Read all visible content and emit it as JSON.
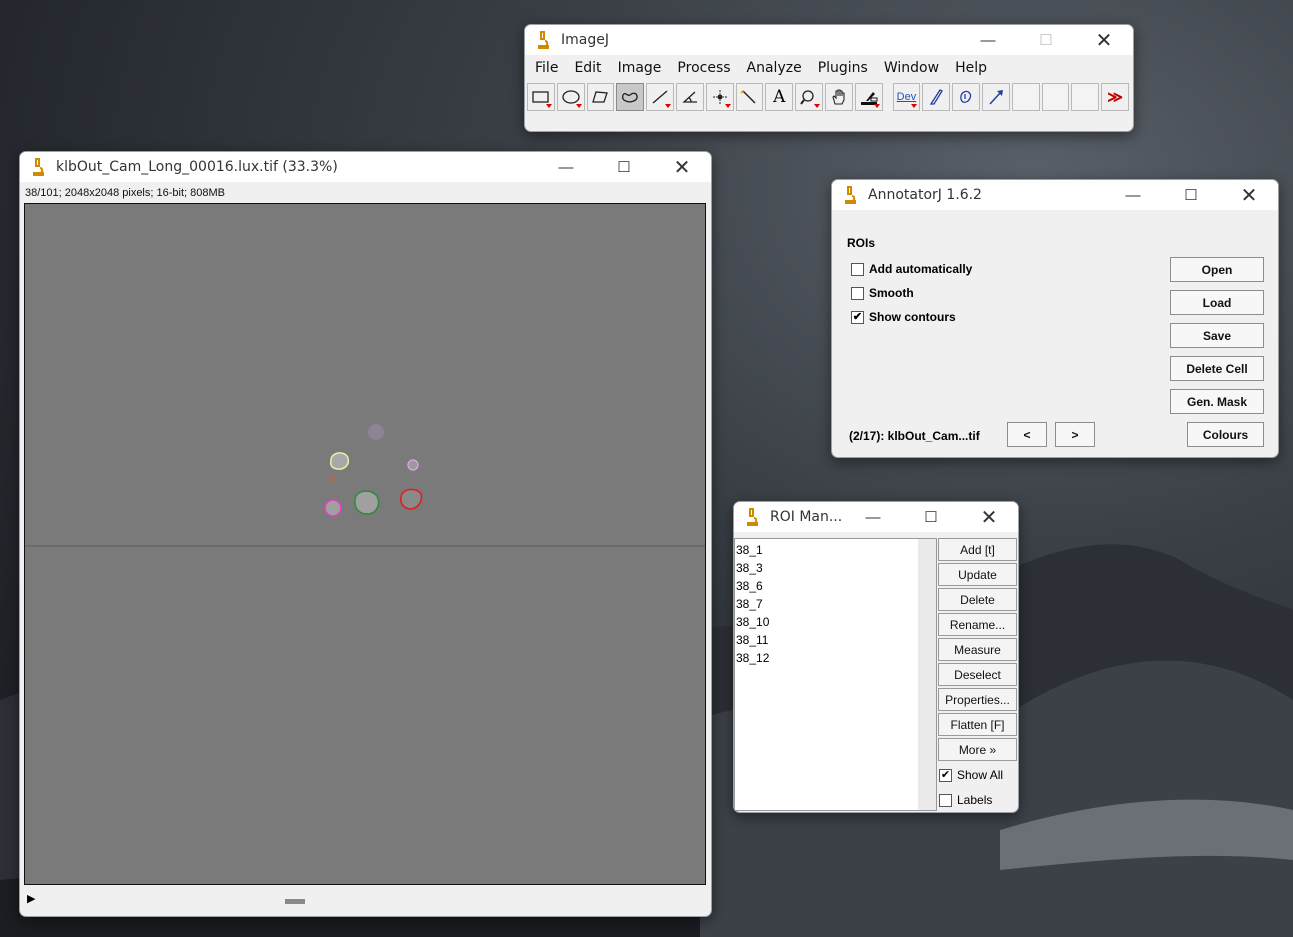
{
  "imagej": {
    "title": "ImageJ",
    "menus": [
      "File",
      "Edit",
      "Image",
      "Process",
      "Analyze",
      "Plugins",
      "Window",
      "Help"
    ],
    "tools": [
      "rectangle-tool-icon",
      "oval-tool-icon",
      "polygon-tool-icon",
      "freehand-tool-icon",
      "line-tool-icon",
      "angle-tool-icon",
      "point-tool-icon",
      "wand-tool-icon",
      "text-tool-icon",
      "magnifier-tool-icon",
      "hand-tool-icon",
      "dropper-tool-icon",
      "dev-tool-icon",
      "brush-tool-icon",
      "flood-fill-tool-icon",
      "arrow-tool-icon",
      "empty-slot",
      "empty-slot",
      "empty-slot",
      "more-tools-icon"
    ],
    "dev_label": "Dev"
  },
  "image_window": {
    "title": "klbOut_Cam_Long_00016.lux.tif (33.3%)",
    "info": "38/101; 2048x2048 pixels; 16-bit; 808MB"
  },
  "annotatorj": {
    "title": "AnnotatorJ 1.6.2",
    "section": "ROIs",
    "checkboxes": [
      {
        "label": "Add automatically",
        "checked": false
      },
      {
        "label": "Smooth",
        "checked": false
      },
      {
        "label": "Show contours",
        "checked": true
      }
    ],
    "buttons": {
      "open": "Open",
      "load": "Load",
      "save": "Save",
      "delete_cell": "Delete Cell",
      "gen_mask": "Gen. Mask",
      "colours": "Colours",
      "prev": "<",
      "next": ">"
    },
    "status": "(2/17): klbOut_Cam...tif"
  },
  "roi_manager": {
    "title": "ROI Man...",
    "items": [
      "38_1",
      "38_3",
      "38_6",
      "38_7",
      "38_10",
      "38_11",
      "38_12"
    ],
    "buttons": {
      "add": "Add [t]",
      "update": "Update",
      "delete": "Delete",
      "rename": "Rename...",
      "measure": "Measure",
      "deselect": "Deselect",
      "properties": "Properties...",
      "flatten": "Flatten [F]",
      "more": "More »"
    },
    "show_all": {
      "label": "Show All",
      "checked": true
    },
    "labels": {
      "label": "Labels",
      "checked": false
    }
  },
  "colors": {
    "roi_green": "#2e8b3a",
    "roi_red": "#e0201a",
    "roi_magenta": "#e040c0",
    "roi_yellow": "#e8f0a0",
    "roi_purple": "#b080d0",
    "roi_pink": "#e6a0e6",
    "roi_orange": "#c86030"
  }
}
